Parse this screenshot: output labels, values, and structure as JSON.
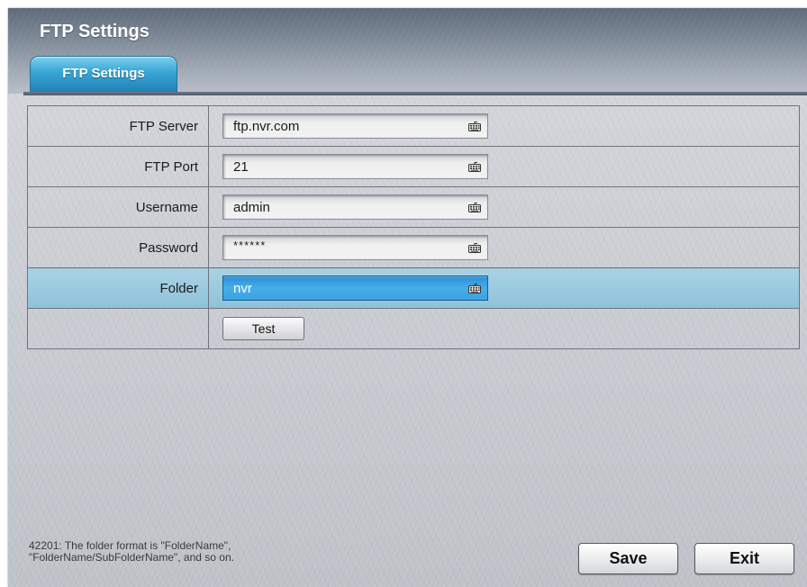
{
  "window": {
    "title": "FTP Settings"
  },
  "tabs": [
    {
      "label": "FTP Settings",
      "active": true
    }
  ],
  "form": {
    "rows": [
      {
        "label": "FTP Server",
        "value": "ftp.nvr.com",
        "icon": "keyboard-icon",
        "selected": false
      },
      {
        "label": "FTP Port",
        "value": "21",
        "icon": "keyboard-icon",
        "selected": false
      },
      {
        "label": "Username",
        "value": "admin",
        "icon": "keyboard-icon",
        "selected": false
      },
      {
        "label": "Password",
        "value": "******",
        "icon": "keyboard-icon",
        "selected": false
      },
      {
        "label": "Folder",
        "value": "nvr",
        "icon": "keyboard-icon",
        "selected": true
      }
    ],
    "test_label": "Test"
  },
  "footer": {
    "hint_line1": "42201: The folder format is \"FolderName\",",
    "hint_line2": "\"FolderName/SubFolderName\", and so on.",
    "save_label": "Save",
    "exit_label": "Exit"
  },
  "colors": {
    "tab_active": "#3aa7d6",
    "selected_row": "#9ccbe0",
    "selected_input": "#3aa2e0",
    "header": "#7d8896"
  }
}
